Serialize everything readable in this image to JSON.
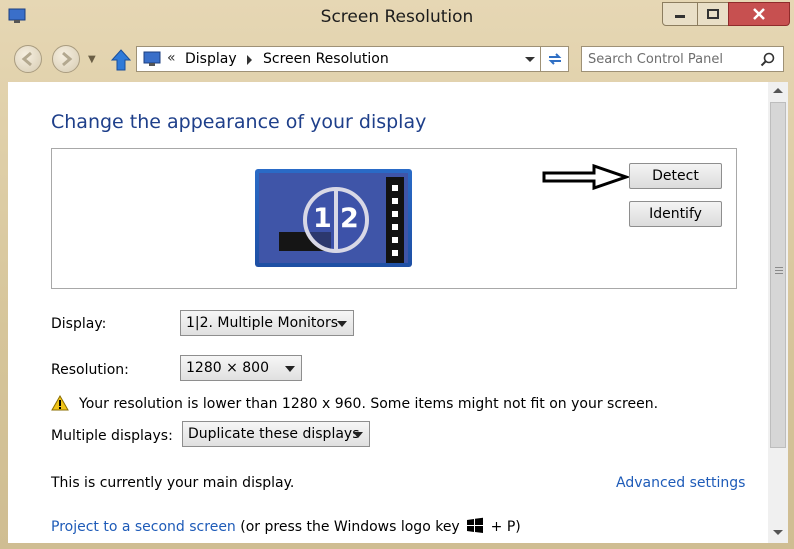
{
  "window": {
    "title": "Screen Resolution",
    "colors": {
      "accent": "#1e3f8a",
      "link": "#1e5bb8",
      "close": "#c75050"
    }
  },
  "address_bar": {
    "chevron": "«",
    "breadcrumbs": [
      "Display",
      "Screen Resolution"
    ]
  },
  "search": {
    "placeholder": "Search Control Panel"
  },
  "content": {
    "heading": "Change the appearance of your display",
    "preview": {
      "monitor_label_1": "1",
      "monitor_label_2": "2"
    },
    "detect_label": "Detect",
    "identify_label": "Identify",
    "display_label": "Display:",
    "display_value": "1|2. Multiple Monitors",
    "resolution_label": "Resolution:",
    "resolution_value": "1280 × 800",
    "warning_text": "Your resolution is lower than 1280 x 960. Some items might not fit on your screen.",
    "multiple_displays_label": "Multiple displays:",
    "multiple_displays_value": "Duplicate these displays",
    "main_display_text": "This is currently your main display.",
    "advanced_settings_link": "Advanced settings",
    "project_link": "Project to a second screen",
    "project_hint": "(or press the Windows logo key",
    "project_hint_end": "+ P)"
  },
  "icons": [
    "display-app-icon",
    "minimize-icon",
    "maximize-icon",
    "close-icon",
    "back-icon",
    "forward-icon",
    "up-arrow-icon",
    "refresh-icon",
    "search-icon",
    "arrow-pointer-icon",
    "warning-icon",
    "windows-logo-icon"
  ]
}
